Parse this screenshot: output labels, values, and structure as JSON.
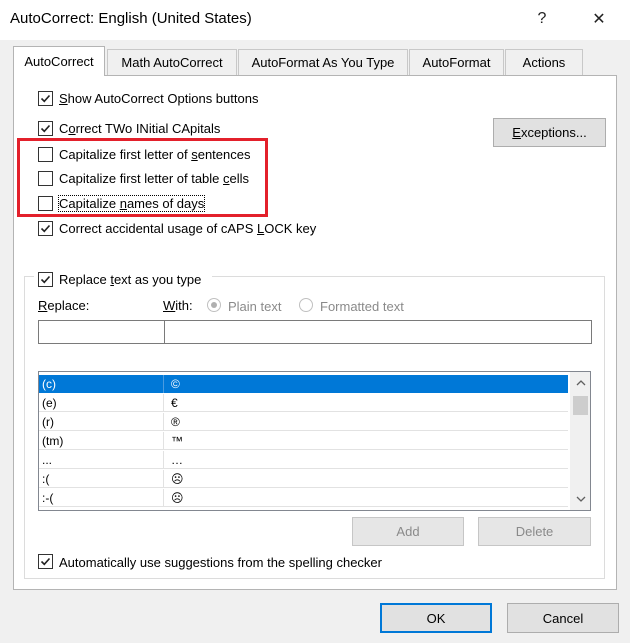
{
  "window": {
    "title": "AutoCorrect: English (United States)",
    "help_label": "?",
    "close_label": "✕"
  },
  "tabs": [
    {
      "label": "AutoCorrect"
    },
    {
      "label": "Math AutoCorrect"
    },
    {
      "label": "AutoFormat As You Type"
    },
    {
      "label": "AutoFormat"
    },
    {
      "label": "Actions"
    }
  ],
  "options": {
    "show_buttons": {
      "pre": "",
      "u": "S",
      "post": "how AutoCorrect Options buttons",
      "checked": true
    },
    "two_initial_caps": {
      "pre": "C",
      "u": "o",
      "post": "rrect TWo INitial CApitals",
      "checked": true
    },
    "first_letter_sentences": {
      "pre": "Capitalize first letter of ",
      "u": "s",
      "post": "entences",
      "checked": false
    },
    "first_letter_table_cells": {
      "pre": "Capitalize first letter of table ",
      "u": "c",
      "post": "ells",
      "checked": false
    },
    "names_of_days": {
      "pre": "Capitalize ",
      "u": "n",
      "post": "ames of days",
      "checked": false
    },
    "caps_lock": {
      "pre": "Correct accidental usage of cAPS ",
      "u": "L",
      "post": "OCK key",
      "checked": true
    }
  },
  "exceptions_button": {
    "pre": "",
    "u": "E",
    "post": "xceptions..."
  },
  "replace_group": {
    "replace_checkbox": {
      "pre": "Replace ",
      "u": "t",
      "post": "ext as you type",
      "checked": true
    },
    "replace_label": {
      "pre": "",
      "u": "R",
      "post": "eplace:"
    },
    "with_label": {
      "pre": "",
      "u": "W",
      "post": "ith:"
    },
    "plain_text_label": "Plain text",
    "formatted_text_label": "Formatted text",
    "replace_value": "",
    "with_value": ""
  },
  "entries": [
    {
      "replace": "(c)",
      "with": "©",
      "selected": true
    },
    {
      "replace": "(e)",
      "with": "€",
      "selected": false
    },
    {
      "replace": "(r)",
      "with": "®",
      "selected": false
    },
    {
      "replace": "(tm)",
      "with": "™",
      "selected": false
    },
    {
      "replace": "...",
      "with": "…",
      "selected": false
    },
    {
      "replace": ":(",
      "with": "☹",
      "selected": false
    },
    {
      "replace": ":-(",
      "with": "☹",
      "selected": false
    }
  ],
  "add_button": "Add",
  "delete_button": "Delete",
  "spelling_suggestions": {
    "pre": "Automatically use suggestions from the spelling checker",
    "u": "",
    "post": "",
    "checked": true
  },
  "ok_button": "OK",
  "cancel_button": "Cancel",
  "colors": {
    "accent": "#0078d7",
    "highlight_box": "#e3202b"
  }
}
